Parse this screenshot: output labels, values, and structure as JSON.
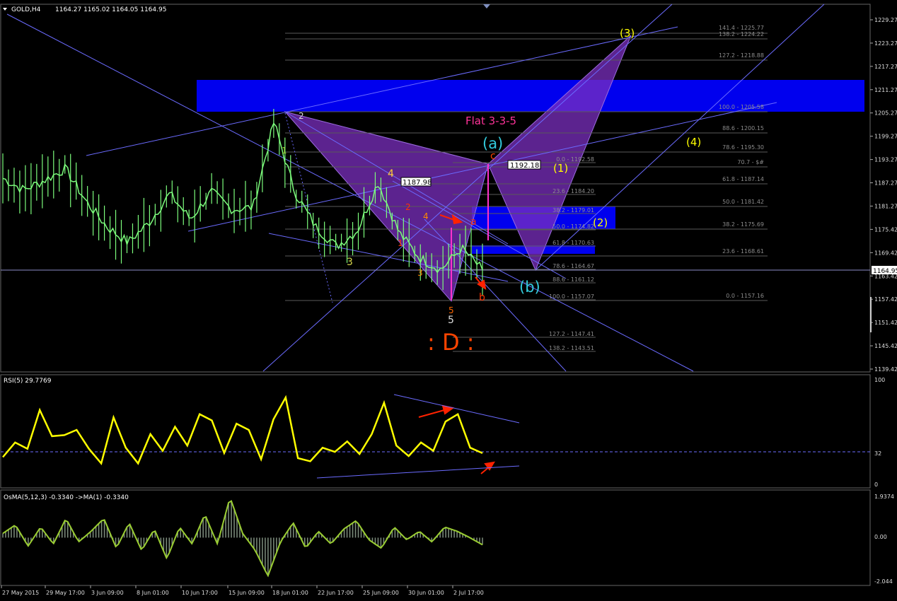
{
  "header": {
    "title": "GOLD,H4",
    "ohlc": "1164.27 1165.02 1164.05 1164.95",
    "rsi_title": "RSI(5) 29.7769",
    "osma_title": "OsMA(5,12,3) -0.3340  ->MA(1) -0.3340"
  },
  "colors": {
    "background": "#000000",
    "candle": "#7cfc7c",
    "rsi_line": "#ffff00",
    "osma_line": "#9acd32",
    "trend_line": "#6b6bff",
    "fib_line": "#606060",
    "zone_blue": "#0000ee",
    "harmonic_purple": "#7b2fbf",
    "wave_yellow": "#ffff00",
    "wave_cyan": "#33ccdd",
    "wave_red": "#ff3300",
    "flat_label": "#ff3399"
  },
  "price_axis": {
    "ticks": [
      "1229.27",
      "1223.27",
      "1217.27",
      "1211.27",
      "1205.27",
      "1199.27",
      "1193.27",
      "1187.27",
      "1181.27",
      "1175.42",
      "1169.42",
      "1163.42",
      "1157.42",
      "1151.42",
      "1145.42",
      "1139.42"
    ],
    "current_price": "1164.95"
  },
  "rsi_axis": {
    "ticks": [
      "100",
      "32",
      "0"
    ]
  },
  "osma_axis": {
    "ticks": [
      "1.9374",
      "0.00",
      "-2.044"
    ]
  },
  "time_axis": {
    "labels": [
      "27 May 2015",
      "29 May 17:00",
      "3 Jun 09:00",
      "8 Jun 01:00",
      "10 Jun 17:00",
      "15 Jun 09:00",
      "18 Jun 01:00",
      "22 Jun 17:00",
      "25 Jun 09:00",
      "30 Jun 01:00",
      "2 Jul 17:00"
    ]
  },
  "fib_right": [
    "141.4 - 1225.77",
    "138.2 - 1224.22",
    "127.2 - 1218.88",
    "100.0 - 1205.58",
    "88.6 - 1200.15",
    "78.6 - 1195.30",
    "70.7 - $#",
    "61.8 - 1187.14",
    "50.0 - 1181.42",
    "38.2 - 1175.69",
    "23.6 - 1168.61",
    "0.0 - 1157.16"
  ],
  "fib_mid": [
    "0.0 - 1192.58",
    "23.6 - 1184.20",
    "38.2 - 1179.01",
    "50.0 - 1174.82",
    "61.8 - 1170.63",
    "78.6 - 1164.67",
    "88.6 - 1161.12",
    "100.0 - 1157.07",
    "127.2 - 1147.41",
    "138.2 - 1143.51"
  ],
  "annotations": {
    "flat_label": "Flat 3-3-5",
    "wave_a_cyan": "(a)",
    "wave_b_cyan": "(b)",
    "wave_c_red": "c",
    "wave_a_red": "a",
    "wave_b_red": "b",
    "wave_1_y": "(1)",
    "wave_2_y": "(2)",
    "wave_3_y": "(3)",
    "wave_4_y": "(4)",
    "price_box_1": "1192.18",
    "price_box_2": "1187.98",
    "d_label": ": D :",
    "minor_1_white": "1",
    "minor_2_white": "2",
    "minor_3_yellow": "3",
    "minor_4_yellow": "4",
    "minor_5_white": "5",
    "minor_1_red": "1",
    "minor_2_red": "2",
    "minor_3_orange": "3",
    "minor_4_orange": "4",
    "minor_5_orange": "5"
  },
  "chart_data": [
    {
      "type": "candlestick",
      "title": "GOLD,H4",
      "ylim": [
        1139.42,
        1229.27
      ],
      "x": [
        "27 May 2015",
        "29 May 17:00",
        "3 Jun 09:00",
        "8 Jun 01:00",
        "10 Jun 17:00",
        "15 Jun 09:00",
        "18 Jun 01:00",
        "22 Jun 17:00",
        "25 Jun 09:00",
        "30 Jun 01:00",
        "2 Jul 17:00"
      ],
      "close_path": [
        1188.5,
        1185.5,
        1188.0,
        1191.0,
        1182.5,
        1176.0,
        1172.0,
        1177.0,
        1184.5,
        1178.0,
        1185.0,
        1180.5,
        1181.0,
        1203.0,
        1185.0,
        1176.0,
        1171.0,
        1175.0,
        1187.5,
        1174.5,
        1168.0,
        1165.0,
        1170.5,
        1164.95
      ],
      "current_price": 1164.95
    },
    {
      "type": "line",
      "title": "RSI(5) 29.7769",
      "ylim": [
        0,
        100
      ],
      "values": [
        26,
        40,
        34,
        71,
        46,
        47,
        52,
        34,
        20,
        64,
        35,
        20,
        48,
        32,
        55,
        37,
        67,
        61,
        30,
        58,
        52,
        24,
        62,
        83,
        25,
        22,
        35,
        31,
        41,
        29,
        48,
        78,
        37,
        27,
        40,
        32,
        60,
        67,
        35,
        29.78
      ],
      "level": 32
    },
    {
      "type": "bar",
      "title": "OsMA(5,12,3) -0.3340  ->MA(1) -0.3340",
      "ylim": [
        -2.044,
        1.9374
      ],
      "values": [
        0.2,
        0.6,
        -0.4,
        0.5,
        -0.3,
        0.9,
        -0.2,
        0.3,
        0.9,
        -0.5,
        0.7,
        -0.6,
        0.4,
        -1.0,
        0.5,
        -0.3,
        1.1,
        -0.3,
        1.9,
        0.2,
        -0.6,
        -1.8,
        -0.2,
        0.7,
        -0.5,
        0.3,
        -0.3,
        0.4,
        0.8,
        -0.1,
        -0.5,
        0.5,
        -0.1,
        0.3,
        -0.2,
        0.5,
        0.3,
        0.0,
        -0.334
      ],
      "ma_value": -0.334
    }
  ]
}
